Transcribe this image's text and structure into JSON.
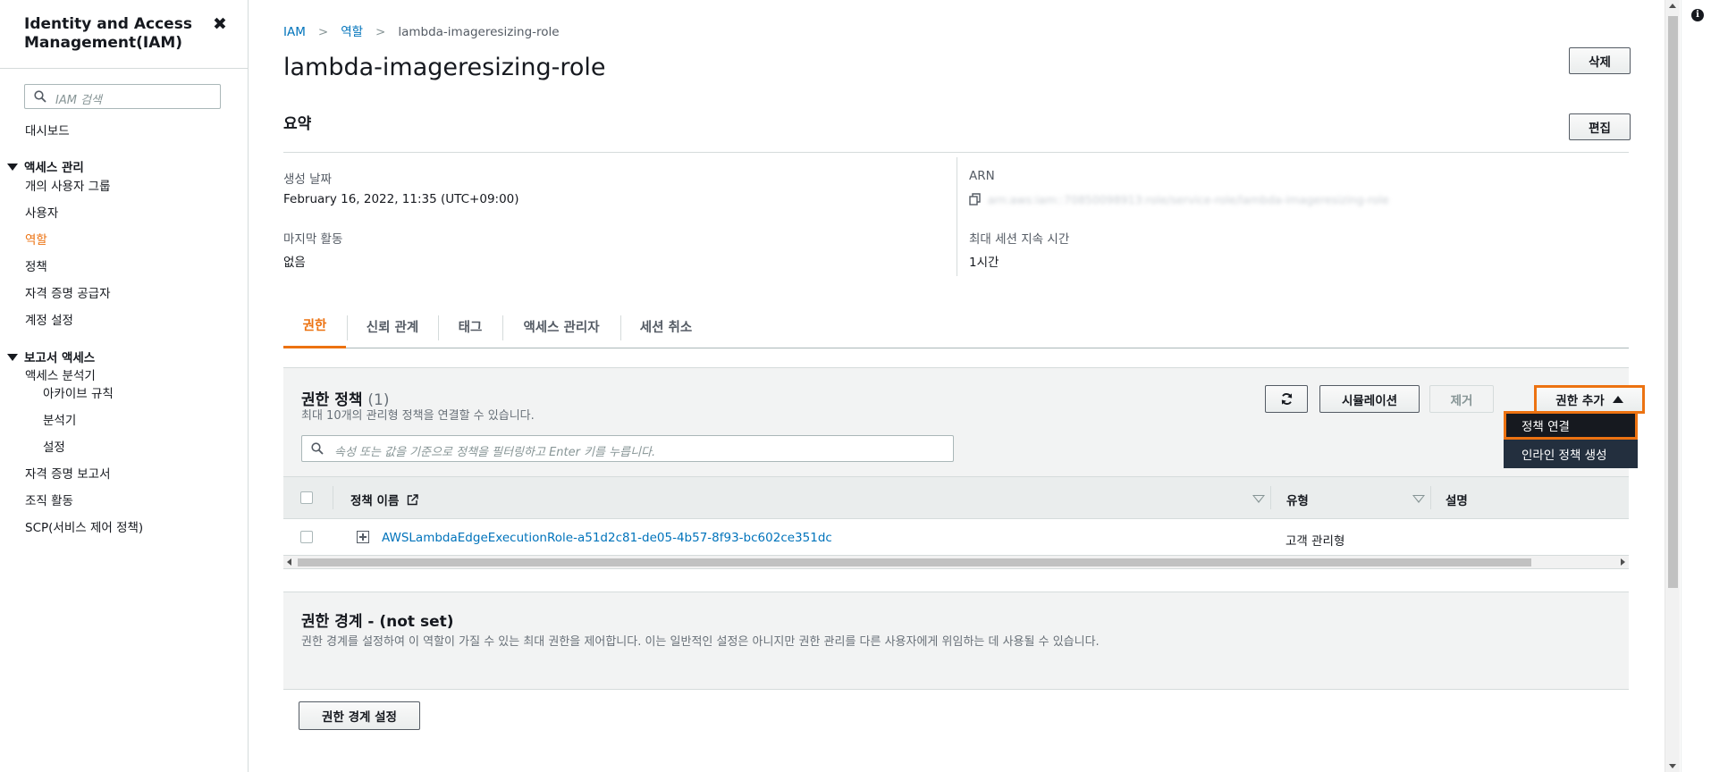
{
  "sidebar": {
    "title": "Identity and Access Management(IAM)",
    "search_placeholder": "IAM 검색",
    "dashboard": "대시보드",
    "access_mgmt": {
      "header": "액세스 관리",
      "items": [
        "개의 사용자 그룹",
        "사용자",
        "역할",
        "정책",
        "자격 증명 공급자",
        "계정 설정"
      ]
    },
    "reports": {
      "header": "보고서 액세스",
      "analyzer": "액세스 분석기",
      "analyzer_items": [
        "아카이브 규칙",
        "분석기",
        "설정"
      ],
      "items": [
        "자격 증명 보고서",
        "조직 활동",
        "SCP(서비스 제어 정책)"
      ]
    },
    "active_item": "역할"
  },
  "breadcrumb": [
    "IAM",
    "역할",
    "lambda-imageresizing-role"
  ],
  "page_title": "lambda-imageresizing-role",
  "buttons": {
    "delete": "삭제",
    "edit": "편집"
  },
  "summary": {
    "heading": "요약",
    "created_label": "생성 날짜",
    "created_value": "February 16, 2022, 11:35 (UTC+09:00)",
    "last_activity_label": "마지막 활동",
    "last_activity_value": "없음",
    "arn_label": "ARN",
    "arn_value": "arn:aws:iam::70850098913:role/service-role/lambda-imageresizing-role",
    "max_session_label": "최대 세션 지속 시간",
    "max_session_value": "1시간"
  },
  "tabs": [
    "권한",
    "신뢰 관계",
    "태그",
    "액세스 관리자",
    "세션 취소"
  ],
  "permissions": {
    "title": "권한 정책",
    "count": "(1)",
    "description": "최대 10개의 관리형 정책을 연결할 수 있습니다.",
    "filter_placeholder": "속성 또는 값을 기준으로 정책을 필터링하고 Enter 키를 누릅니다.",
    "simulation": "시뮬레이션",
    "remove": "제거",
    "add": "권한 추가",
    "dropdown": [
      "정책 연결",
      "인라인 정책 생성"
    ],
    "columns": [
      "정책 이름",
      "유형",
      "설명"
    ],
    "rows": [
      {
        "name": "AWSLambdaEdgeExecutionRole-a51d2c81-de05-4b57-8f93-bc602ce351dc",
        "type": "고객 관리형"
      }
    ]
  },
  "boundary": {
    "title": "권한 경계 - (not set)",
    "description": "권한 경계를 설정하여 이 역할이 가질 수 있는 최대 권한을 제어합니다. 이는 일반적인 설정은 아니지만 권한 관리를 다른 사용자에게 위임하는 데 사용될 수 있습니다.",
    "button": "권한 경계 설정"
  },
  "colors": {
    "accent": "#ec7211",
    "link": "#0073bb",
    "dropdown_bg": "#232f3e"
  }
}
